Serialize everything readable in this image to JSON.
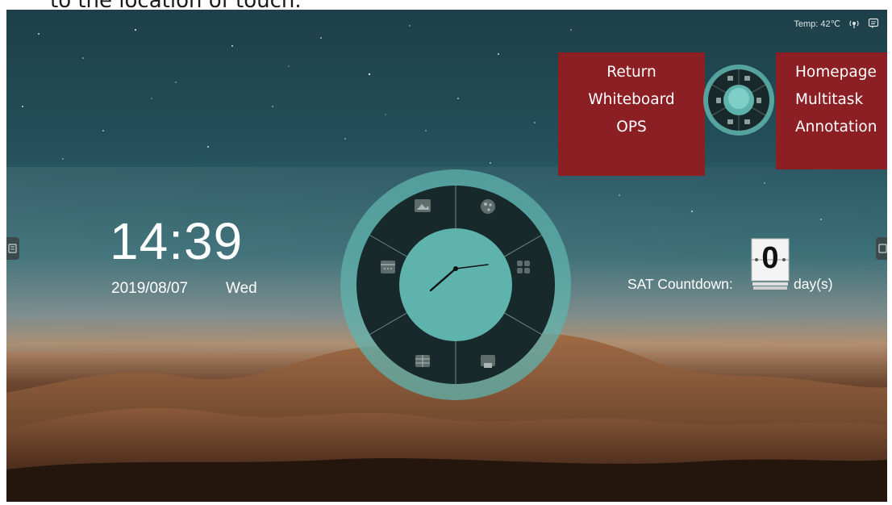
{
  "caption": "to the location of touch.",
  "status": {
    "temp": "Temp: 42℃"
  },
  "clock": {
    "time": "14:39",
    "date": "2019/08/07",
    "weekday": "Wed"
  },
  "callout_left": {
    "lines": [
      "Return",
      "Whiteboard",
      "OPS"
    ]
  },
  "callout_right": {
    "lines": [
      "Homepage",
      "Multitask",
      "Annotation"
    ]
  },
  "countdown": {
    "label": "SAT Countdown:",
    "value": "0",
    "unit": "day(s)"
  },
  "dial_icons": [
    "image-icon",
    "palette-icon",
    "apps-grid-icon",
    "screen-share-icon",
    "table-icon",
    "calendar-icon"
  ],
  "small_dial_icons": [
    "tools-icon",
    "basket-icon",
    "window-icon",
    "pen-icon",
    "shapes-icon",
    "home-icon"
  ],
  "colors": {
    "accent": "#5fb3ad",
    "callout": "#8b1f24",
    "dial_dark": "#17292a"
  }
}
